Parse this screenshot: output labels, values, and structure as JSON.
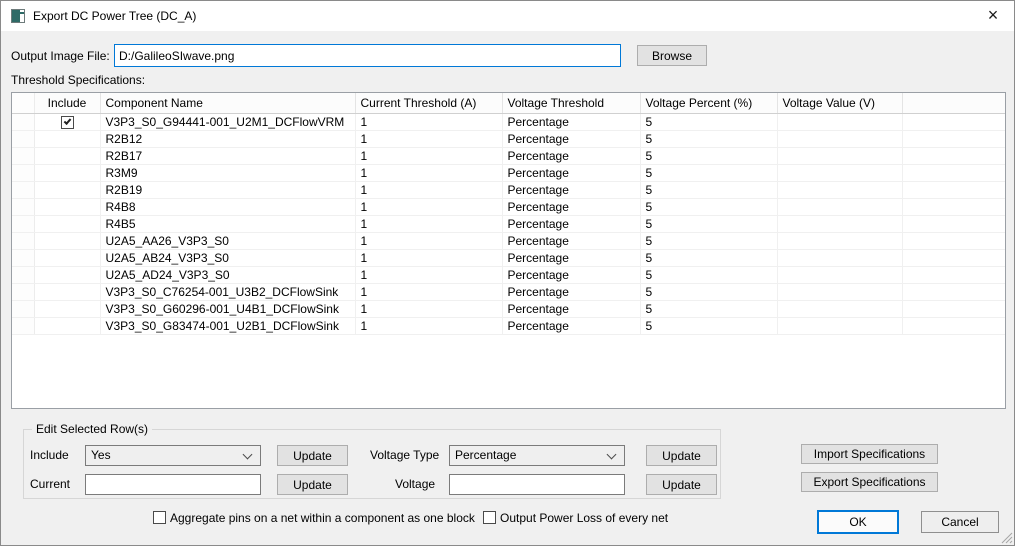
{
  "window": {
    "title": "Export DC Power Tree (DC_A)",
    "close_glyph": "×"
  },
  "output_file": {
    "label": "Output Image File:",
    "value": "D:/GalileoSIwave.png",
    "browse": "Browse"
  },
  "threshold": {
    "label": "Threshold Specifications:",
    "columns": [
      "Include",
      "Component Name",
      "Current Threshold (A)",
      "Voltage Threshold",
      "Voltage Percent (%)",
      "Voltage Value (V)"
    ],
    "rows": [
      {
        "include": true,
        "component": "V3P3_S0_G94441-001_U2M1_DCFlowVRM",
        "current": "1",
        "voltage_threshold": "Percentage",
        "voltage_percent": "5",
        "voltage_value": ""
      },
      {
        "include": false,
        "component": "R2B12",
        "current": "1",
        "voltage_threshold": "Percentage",
        "voltage_percent": "5",
        "voltage_value": ""
      },
      {
        "include": false,
        "component": "R2B17",
        "current": "1",
        "voltage_threshold": "Percentage",
        "voltage_percent": "5",
        "voltage_value": ""
      },
      {
        "include": false,
        "component": "R3M9",
        "current": "1",
        "voltage_threshold": "Percentage",
        "voltage_percent": "5",
        "voltage_value": ""
      },
      {
        "include": false,
        "component": "R2B19",
        "current": "1",
        "voltage_threshold": "Percentage",
        "voltage_percent": "5",
        "voltage_value": ""
      },
      {
        "include": false,
        "component": "R4B8",
        "current": "1",
        "voltage_threshold": "Percentage",
        "voltage_percent": "5",
        "voltage_value": ""
      },
      {
        "include": false,
        "component": "R4B5",
        "current": "1",
        "voltage_threshold": "Percentage",
        "voltage_percent": "5",
        "voltage_value": ""
      },
      {
        "include": false,
        "component": "U2A5_AA26_V3P3_S0",
        "current": "1",
        "voltage_threshold": "Percentage",
        "voltage_percent": "5",
        "voltage_value": ""
      },
      {
        "include": false,
        "component": "U2A5_AB24_V3P3_S0",
        "current": "1",
        "voltage_threshold": "Percentage",
        "voltage_percent": "5",
        "voltage_value": ""
      },
      {
        "include": false,
        "component": "U2A5_AD24_V3P3_S0",
        "current": "1",
        "voltage_threshold": "Percentage",
        "voltage_percent": "5",
        "voltage_value": ""
      },
      {
        "include": false,
        "component": "V3P3_S0_C76254-001_U3B2_DCFlowSink",
        "current": "1",
        "voltage_threshold": "Percentage",
        "voltage_percent": "5",
        "voltage_value": ""
      },
      {
        "include": false,
        "component": "V3P3_S0_G60296-001_U4B1_DCFlowSink",
        "current": "1",
        "voltage_threshold": "Percentage",
        "voltage_percent": "5",
        "voltage_value": ""
      },
      {
        "include": false,
        "component": "V3P3_S0_G83474-001_U2B1_DCFlowSink",
        "current": "1",
        "voltage_threshold": "Percentage",
        "voltage_percent": "5",
        "voltage_value": ""
      }
    ]
  },
  "edit_panel": {
    "title": "Edit Selected Row(s)",
    "include_label": "Include",
    "include_value": "Yes",
    "voltage_type_label": "Voltage Type",
    "voltage_type_value": "Percentage",
    "current_label": "Current",
    "current_value": "",
    "voltage_label": "Voltage",
    "voltage_value": "",
    "update": "Update",
    "import": "Import Specifications",
    "export": "Export Specifications"
  },
  "options": {
    "aggregate": "Aggregate pins on a net within a component as one block",
    "power_loss": "Output Power Loss of every net"
  },
  "actions": {
    "ok": "OK",
    "cancel": "Cancel"
  },
  "colors": {
    "accent": "#0078d7",
    "titlebar": "#ffffff",
    "dialog_bg": "#f0f0f0"
  }
}
